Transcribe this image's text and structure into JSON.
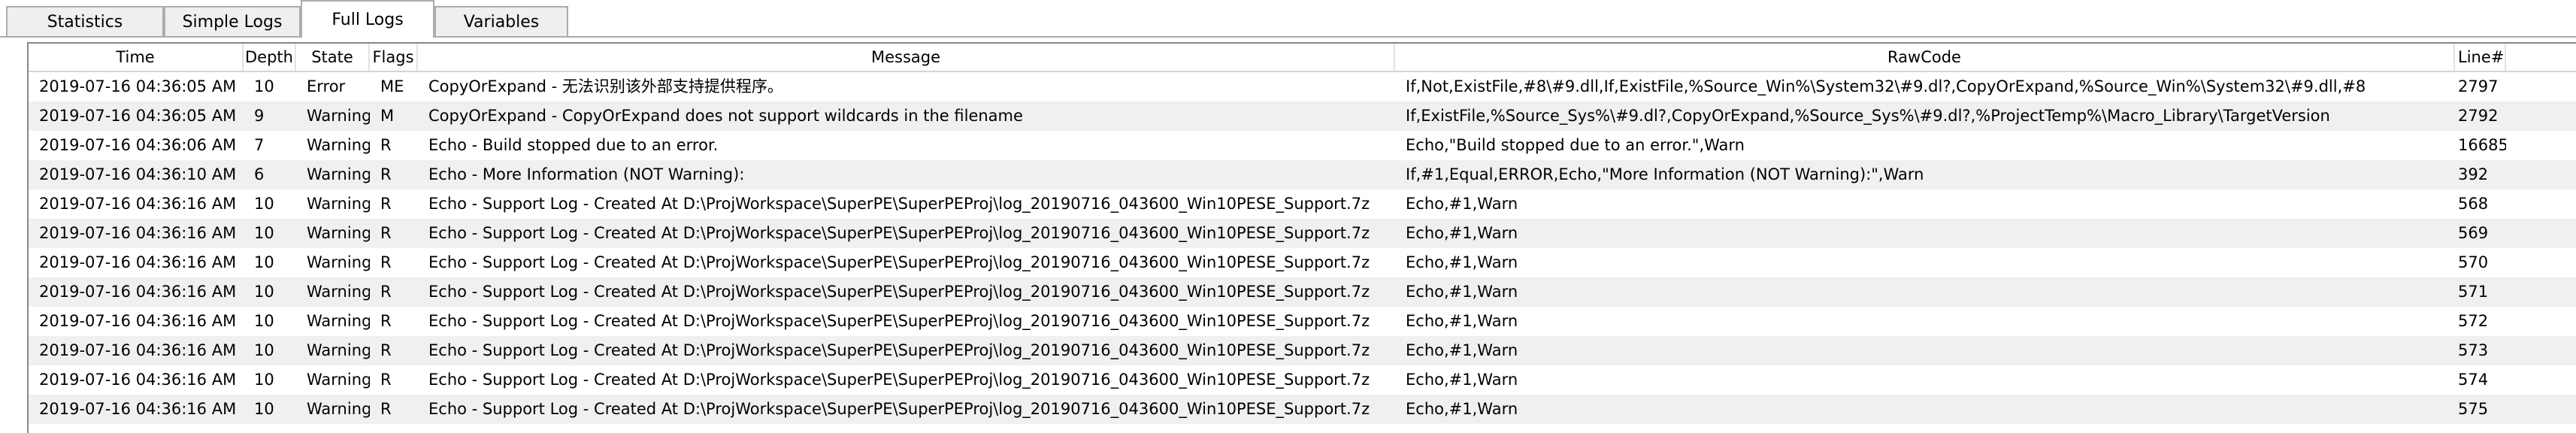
{
  "tabs": [
    {
      "label": "Statistics"
    },
    {
      "label": "Simple Logs"
    },
    {
      "label": "Full Logs"
    },
    {
      "label": "Variables"
    }
  ],
  "active_tab": "Full Logs",
  "columns": {
    "time": "Time",
    "depth": "Depth",
    "state": "State",
    "flags": "Flags",
    "message": "Message",
    "rawcode": "RawCode",
    "line": "Line#"
  },
  "rows": [
    {
      "time": "2019-07-16 04:36:05 AM",
      "depth": "10",
      "state": "Error",
      "flags": "ME",
      "message": "CopyOrExpand - 无法识别该外部支持提供程序。",
      "rawcode": "If,Not,ExistFile,#8\\#9.dll,If,ExistFile,%Source_Win%\\System32\\#9.dl?,CopyOrExpand,%Source_Win%\\System32\\#9.dll,#8",
      "line": "2797"
    },
    {
      "time": "2019-07-16 04:36:05 AM",
      "depth": "9",
      "state": "Warning",
      "flags": "M",
      "message": "CopyOrExpand - CopyOrExpand does not support wildcards in the filename",
      "rawcode": "If,ExistFile,%Source_Sys%\\#9.dl?,CopyOrExpand,%Source_Sys%\\#9.dl?,%ProjectTemp%\\Macro_Library\\TargetVersion",
      "line": "2792"
    },
    {
      "time": "2019-07-16 04:36:06 AM",
      "depth": "7",
      "state": "Warning",
      "flags": "R",
      "message": "Echo - Build stopped due to an error.",
      "rawcode": "Echo,\"Build stopped due to an error.\",Warn",
      "line": "16685"
    },
    {
      "time": "2019-07-16 04:36:10 AM",
      "depth": "6",
      "state": "Warning",
      "flags": "R",
      "message": "Echo - More Information (NOT Warning):",
      "rawcode": "If,#1,Equal,ERROR,Echo,\"More Information (NOT Warning):\",Warn",
      "line": "392"
    },
    {
      "time": "2019-07-16 04:36:16 AM",
      "depth": "10",
      "state": "Warning",
      "flags": "R",
      "message": "Echo - Support Log - Created At D:\\ProjWorkspace\\SuperPE\\SuperPEProj\\log_20190716_043600_Win10PESE_Support.7z",
      "rawcode": "Echo,#1,Warn",
      "line": "568"
    },
    {
      "time": "2019-07-16 04:36:16 AM",
      "depth": "10",
      "state": "Warning",
      "flags": "R",
      "message": "Echo - Support Log - Created At D:\\ProjWorkspace\\SuperPE\\SuperPEProj\\log_20190716_043600_Win10PESE_Support.7z",
      "rawcode": "Echo,#1,Warn",
      "line": "569"
    },
    {
      "time": "2019-07-16 04:36:16 AM",
      "depth": "10",
      "state": "Warning",
      "flags": "R",
      "message": "Echo - Support Log - Created At D:\\ProjWorkspace\\SuperPE\\SuperPEProj\\log_20190716_043600_Win10PESE_Support.7z",
      "rawcode": "Echo,#1,Warn",
      "line": "570"
    },
    {
      "time": "2019-07-16 04:36:16 AM",
      "depth": "10",
      "state": "Warning",
      "flags": "R",
      "message": "Echo - Support Log - Created At D:\\ProjWorkspace\\SuperPE\\SuperPEProj\\log_20190716_043600_Win10PESE_Support.7z",
      "rawcode": "Echo,#1,Warn",
      "line": "571"
    },
    {
      "time": "2019-07-16 04:36:16 AM",
      "depth": "10",
      "state": "Warning",
      "flags": "R",
      "message": "Echo - Support Log - Created At D:\\ProjWorkspace\\SuperPE\\SuperPEProj\\log_20190716_043600_Win10PESE_Support.7z",
      "rawcode": "Echo,#1,Warn",
      "line": "572"
    },
    {
      "time": "2019-07-16 04:36:16 AM",
      "depth": "10",
      "state": "Warning",
      "flags": "R",
      "message": "Echo - Support Log - Created At D:\\ProjWorkspace\\SuperPE\\SuperPEProj\\log_20190716_043600_Win10PESE_Support.7z",
      "rawcode": "Echo,#1,Warn",
      "line": "573"
    },
    {
      "time": "2019-07-16 04:36:16 AM",
      "depth": "10",
      "state": "Warning",
      "flags": "R",
      "message": "Echo - Support Log - Created At D:\\ProjWorkspace\\SuperPE\\SuperPEProj\\log_20190716_043600_Win10PESE_Support.7z",
      "rawcode": "Echo,#1,Warn",
      "line": "574"
    },
    {
      "time": "2019-07-16 04:36:16 AM",
      "depth": "10",
      "state": "Warning",
      "flags": "R",
      "message": "Echo - Support Log - Created At D:\\ProjWorkspace\\SuperPE\\SuperPEProj\\log_20190716_043600_Win10PESE_Support.7z",
      "rawcode": "Echo,#1,Warn",
      "line": "575"
    }
  ]
}
